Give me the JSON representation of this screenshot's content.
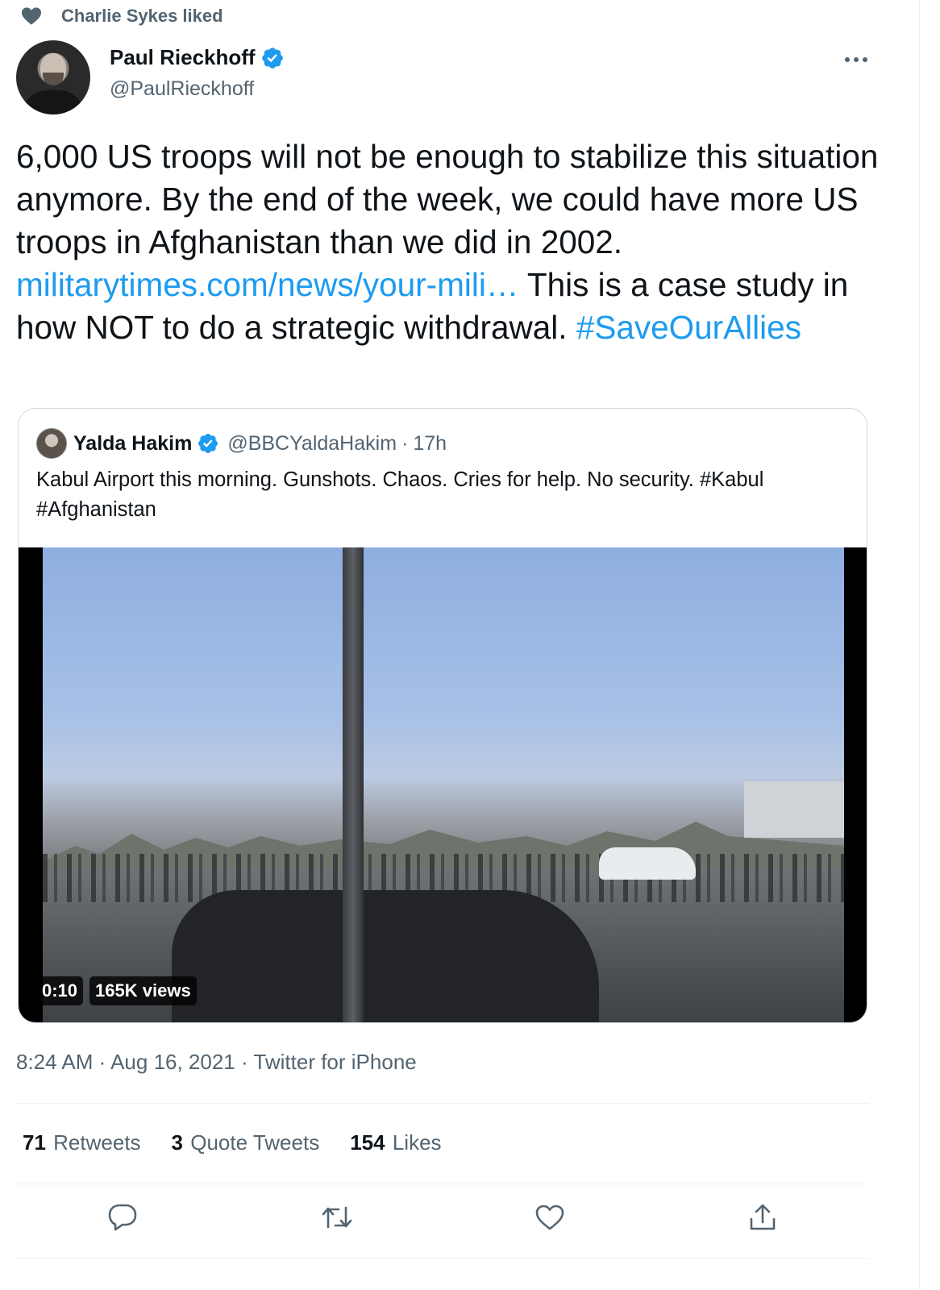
{
  "social_context": {
    "icon": "heart-icon",
    "text": "Charlie Sykes liked"
  },
  "author": {
    "display_name": "Paul Rieckhoff",
    "handle": "@PaulRieckhoff",
    "verified": true,
    "avatar_icon": "avatar"
  },
  "more_icon": "more-dots-icon",
  "tweet": {
    "text_part1": "6,000 US troops will not be enough to stabilize this situation anymore. By the end of the week, we could have more US troops in Afghanistan than we did in 2002. ",
    "link": "militarytimes.com/news/your-mili…",
    "text_part2": " This is a case study in how NOT to do a strategic withdrawal. ",
    "hashtag": "#SaveOurAllies"
  },
  "quoted": {
    "display_name": "Yalda Hakim",
    "handle": "@BBCYaldaHakim",
    "separator": "·",
    "time": "17h",
    "text": "Kabul Airport this morning. Gunshots. Chaos. Cries for help. No security. #Kabul #Afghanistan",
    "video": {
      "duration": "0:10",
      "views": "165K views"
    }
  },
  "meta": {
    "time": "8:24 AM",
    "sep": " · ",
    "date": "Aug 16, 2021",
    "source": "Twitter for iPhone"
  },
  "stats": [
    {
      "count": "71",
      "label": "Retweets"
    },
    {
      "count": "3",
      "label": "Quote Tweets"
    },
    {
      "count": "154",
      "label": "Likes"
    }
  ],
  "actions": [
    {
      "icon": "reply-icon"
    },
    {
      "icon": "retweet-icon"
    },
    {
      "icon": "like-icon"
    },
    {
      "icon": "share-icon"
    }
  ],
  "colors": {
    "link": "#1d9bf0",
    "secondary_text": "#536471",
    "primary_text": "#0f1419",
    "border": "#cfd9de"
  }
}
